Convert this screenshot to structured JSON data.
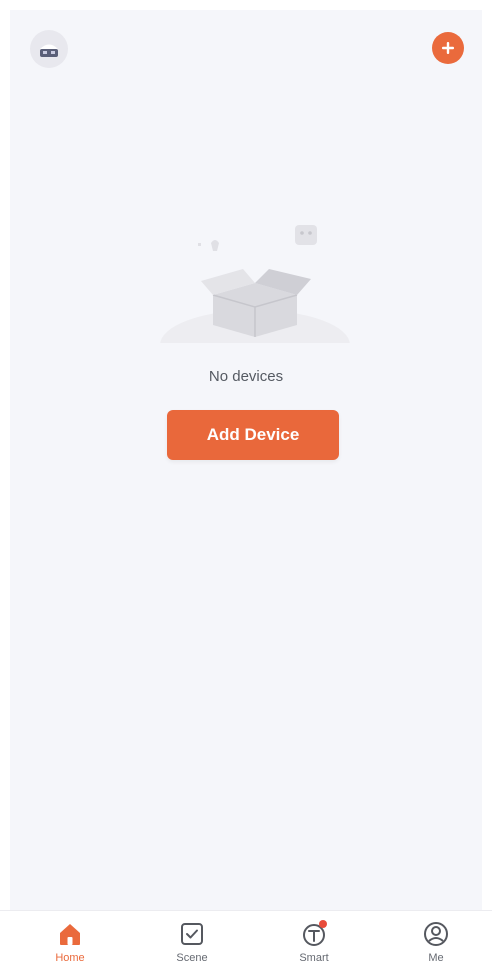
{
  "header": {
    "avatar_icon": "home-switch-icon",
    "add_icon": "plus-icon"
  },
  "empty_state": {
    "illustration": "empty-box-illustration",
    "message": "No devices",
    "button_label": "Add Device"
  },
  "tabbar": {
    "items": [
      {
        "label": "Home",
        "icon": "home-icon",
        "active": true
      },
      {
        "label": "Scene",
        "icon": "scene-checkbox-icon",
        "active": false
      },
      {
        "label": "Smart",
        "icon": "smart-icon",
        "active": false,
        "badge": true
      },
      {
        "label": "Me",
        "icon": "profile-icon",
        "active": false
      }
    ]
  },
  "colors": {
    "accent": "#ea6a3c",
    "background": "#f5f6fa",
    "badge": "#e84b3a"
  }
}
